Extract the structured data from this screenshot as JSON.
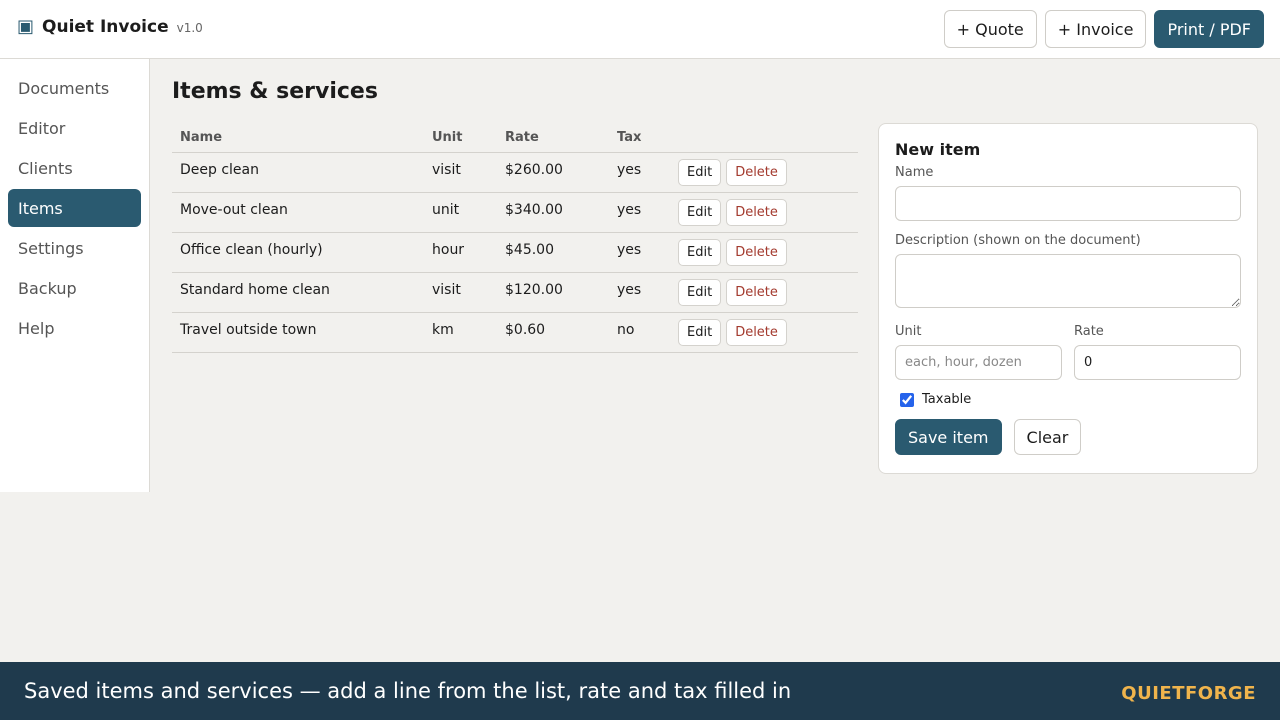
{
  "app": {
    "name": "Quiet Invoice",
    "version": "v1.0",
    "icon": "document-icon"
  },
  "top_actions": {
    "quote": "+ Quote",
    "invoice": "+ Invoice",
    "print": "Print / PDF"
  },
  "sidebar": {
    "items": [
      {
        "label": "Documents",
        "active": false
      },
      {
        "label": "Editor",
        "active": false
      },
      {
        "label": "Clients",
        "active": false
      },
      {
        "label": "Items",
        "active": true
      },
      {
        "label": "Settings",
        "active": false
      },
      {
        "label": "Backup",
        "active": false
      },
      {
        "label": "Help",
        "active": false
      }
    ]
  },
  "page": {
    "title": "Items & services"
  },
  "table": {
    "headers": {
      "name": "Name",
      "unit": "Unit",
      "rate": "Rate",
      "tax": "Tax"
    },
    "edit_label": "Edit",
    "delete_label": "Delete",
    "rows": [
      {
        "name": "Deep clean",
        "unit": "visit",
        "rate": "$260.00",
        "tax": "yes"
      },
      {
        "name": "Move-out clean",
        "unit": "unit",
        "rate": "$340.00",
        "tax": "yes"
      },
      {
        "name": "Office clean (hourly)",
        "unit": "hour",
        "rate": "$45.00",
        "tax": "yes"
      },
      {
        "name": "Standard home clean",
        "unit": "visit",
        "rate": "$120.00",
        "tax": "yes"
      },
      {
        "name": "Travel outside town",
        "unit": "km",
        "rate": "$0.60",
        "tax": "no"
      }
    ]
  },
  "form": {
    "title": "New item",
    "name_label": "Name",
    "name_value": "",
    "description_label": "Description (shown on the document)",
    "description_value": "",
    "unit_label": "Unit",
    "unit_placeholder": "each, hour, dozen",
    "unit_value": "",
    "rate_label": "Rate",
    "rate_value": "0",
    "taxable_label": "Taxable",
    "taxable_checked": true,
    "save_label": "Save item",
    "clear_label": "Clear"
  },
  "footer": {
    "caption": "Saved items and services — add a line from the list, rate and tax filled in",
    "brand": "QUIETFORGE"
  },
  "colors": {
    "accent": "#2a5a70",
    "footer_bg": "#1f3a4d",
    "footer_brand": "#f0b44c",
    "delete": "#a33a2e"
  }
}
